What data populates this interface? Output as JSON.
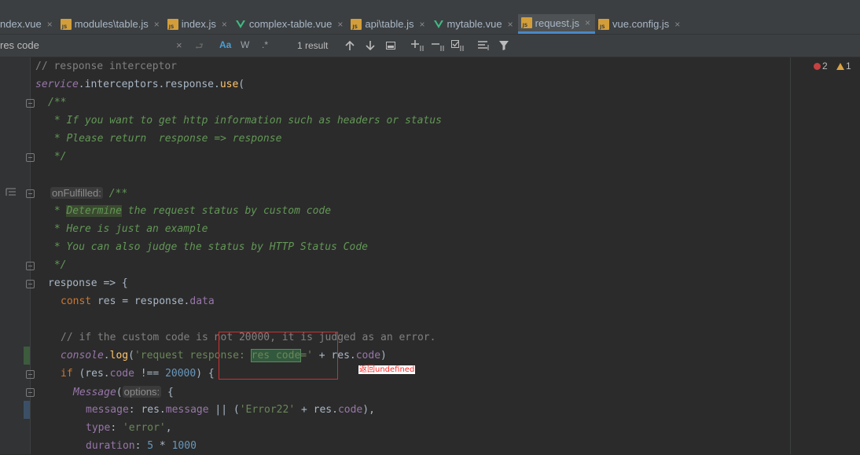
{
  "tabs": [
    {
      "label": "ndex.vue",
      "icon": "vue-icon",
      "close": "×"
    },
    {
      "label": "modules\\table.js",
      "icon": "js-file-icon",
      "close": "×"
    },
    {
      "label": "index.js",
      "icon": "js-file-icon",
      "close": "×"
    },
    {
      "label": "complex-table.vue",
      "icon": "vue-icon",
      "close": "×"
    },
    {
      "label": "api\\table.js",
      "icon": "js-file-icon",
      "close": "×"
    },
    {
      "label": "mytable.vue",
      "icon": "vue-icon",
      "close": "×"
    },
    {
      "label": "request.js",
      "icon": "js-file-icon",
      "close": "×",
      "active": true
    },
    {
      "label": "vue.config.js",
      "icon": "js-file-icon",
      "close": "×"
    }
  ],
  "find": {
    "query": "res code",
    "clear": "×",
    "match_case": "Aa",
    "words": "W",
    "regex": ".*",
    "results": "1 result"
  },
  "inspections": {
    "errors": "2",
    "warnings": "1"
  },
  "code": {
    "l1": "// response interceptor",
    "l2_obj": "service",
    "l2_rest": ".interceptors.response.",
    "l2_fn": "use",
    "l2_paren": "(",
    "l3": "/**",
    "l4": " * If you want to get http information such as headers or status",
    "l5": " * Please return  response => response",
    "l6": " */",
    "l8_hint": "onFulfilled:",
    "l8": "/**",
    "l9_a": " * ",
    "l9_hl": "Determine",
    "l9_b": " the request status by custom code",
    "l10": " * Here is just an example",
    "l11": " * You can also judge the status by HTTP Status Code",
    "l12": " */",
    "l13": "response => {",
    "l14_kw": "const",
    "l14_a": " res = response.",
    "l14_prop": "data",
    "l16": "// if the custom code is not 20000, it is judged as an error.",
    "l17_obj": "console",
    "l17_dot": ".",
    "l17_fn": "log",
    "l17_p": "(",
    "l17_s1": "'request response: ",
    "l17_match": "res code",
    "l17_s2": "='",
    "l17_plus": " + res.",
    "l17_prop": "code",
    "l17_end": ")",
    "l18_kw": "if",
    "l18_a": " (res.",
    "l18_prop": "code",
    "l18_b": " !== ",
    "l18_num": "20000",
    "l18_c": ") {",
    "l19_fn": "Message",
    "l19_p": "(",
    "l19_hint": "options:",
    "l19_b": " {",
    "l20_prop": "message",
    "l20_a": ": res.",
    "l20_prop2": "message",
    "l20_b": " || (",
    "l20_str": "'Error22'",
    "l20_c": " + res.",
    "l20_prop3": "code",
    "l20_d": "),",
    "l21_prop": "type",
    "l21_a": ": ",
    "l21_str": "'error'",
    "l21_b": ",",
    "l22_prop": "duration",
    "l22_a": ": ",
    "l22_num": "5",
    "l22_b": " * ",
    "l22_num2": "1000"
  },
  "annotation": "返回undefined",
  "colors": {
    "comment": "#808080",
    "doc": "#629755",
    "keyword": "#cc7832",
    "string": "#6a8759",
    "number": "#6897bb",
    "property": "#9876aa",
    "function": "#ffc66d",
    "annotation": "#ff2a2a"
  }
}
